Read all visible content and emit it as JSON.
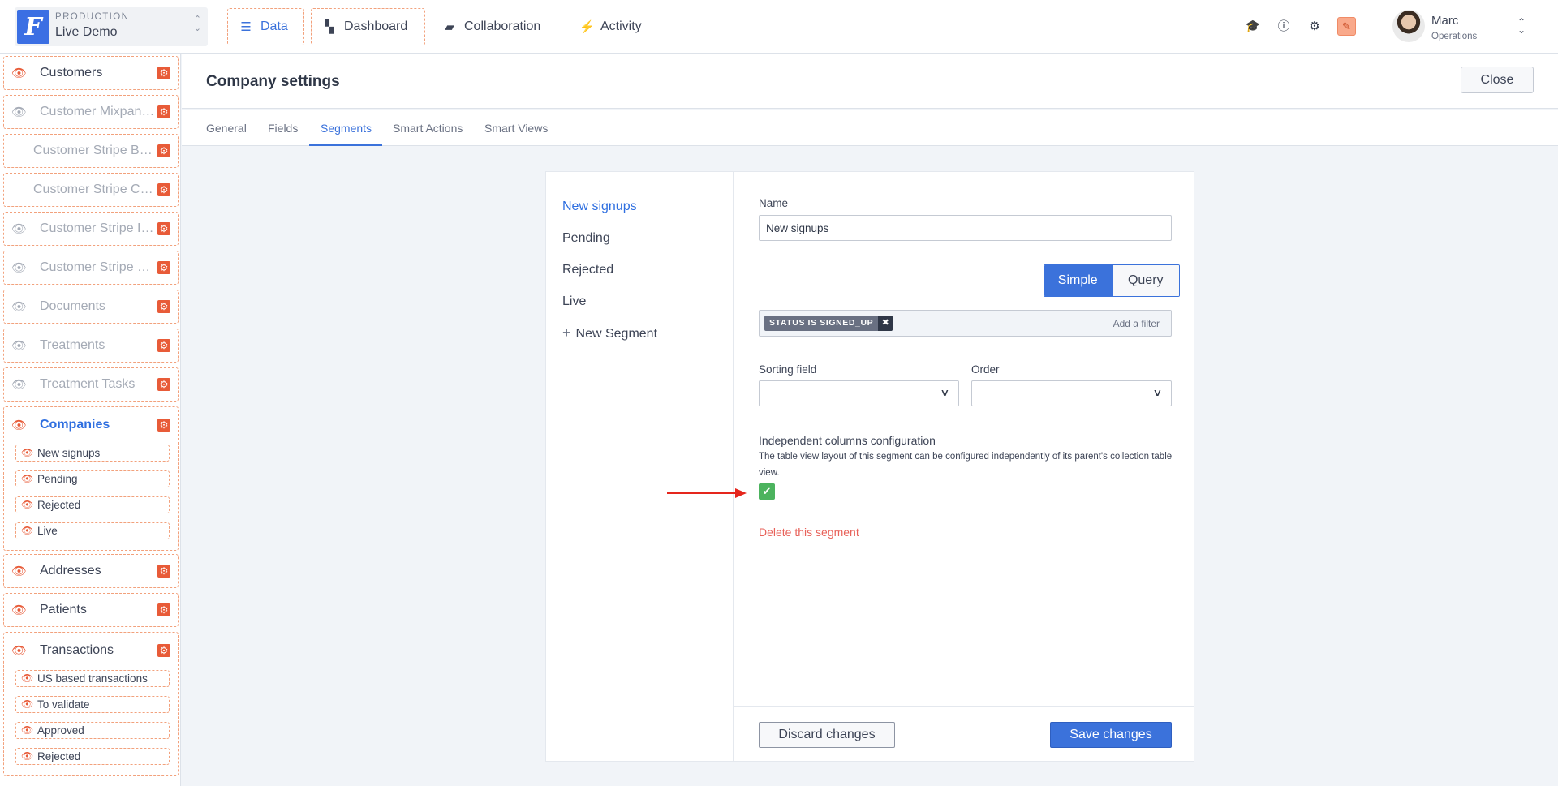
{
  "topbar": {
    "logo_letter": "F",
    "environment": "PRODUCTION",
    "project": "Live Demo",
    "nav": [
      {
        "label": "Data",
        "icon": "list-icon"
      },
      {
        "label": "Dashboard",
        "icon": "dashboard-icon"
      },
      {
        "label": "Collaboration",
        "icon": "chat-icon"
      },
      {
        "label": "Activity",
        "icon": "bolt-icon"
      }
    ],
    "icons": [
      "graduation-cap-icon",
      "help-icon",
      "gear-icon",
      "brush-icon"
    ],
    "user": {
      "name": "Marc",
      "role": "Operations"
    }
  },
  "sidebar": {
    "collections": [
      {
        "label": "Customers",
        "visible": true
      },
      {
        "label": "Customer Mixpanel Events",
        "visible": false
      },
      {
        "label": "Customer Stripe Bank Accounts",
        "visible": false,
        "no_eye": true
      },
      {
        "label": "Customer Stripe Cards",
        "visible": false,
        "no_eye": true
      },
      {
        "label": "Customer Stripe Invoices",
        "visible": false
      },
      {
        "label": "Customer Stripe Payments",
        "visible": false
      },
      {
        "label": "Documents",
        "visible": false
      },
      {
        "label": "Treatments",
        "visible": false
      },
      {
        "label": "Treatment Tasks",
        "visible": false
      }
    ],
    "companies": {
      "label": "Companies",
      "segments": [
        "New signups",
        "Pending",
        "Rejected",
        "Live"
      ]
    },
    "after": [
      {
        "label": "Addresses"
      },
      {
        "label": "Patients"
      }
    ],
    "transactions": {
      "label": "Transactions",
      "segments": [
        "US based transactions",
        "To validate",
        "Approved",
        "Rejected"
      ]
    }
  },
  "settings": {
    "title": "Company settings",
    "close_label": "Close",
    "tabs": [
      "General",
      "Fields",
      "Segments",
      "Smart Actions",
      "Smart Views"
    ],
    "active_tab": "Segments"
  },
  "segments": {
    "list": [
      "New signups",
      "Pending",
      "Rejected",
      "Live"
    ],
    "new_segment_label": "New Segment",
    "selected": "New signups"
  },
  "form": {
    "name_label": "Name",
    "name_value": "New signups",
    "mode_simple": "Simple",
    "mode_query": "Query",
    "active_mode": "Simple",
    "filter_chip": "STATUS IS SIGNED_UP",
    "add_filter": "Add a filter",
    "sorting_label": "Sorting field",
    "order_label": "Order",
    "sorting_value": "",
    "order_value": "",
    "indep_label": "Independent columns configuration",
    "indep_desc": "The table view layout of this segment can be configured independently of its parent's collection table view.",
    "indep_checked": true,
    "delete_label": "Delete this segment",
    "discard_label": "Discard changes",
    "save_label": "Save changes"
  },
  "colors": {
    "accent": "#3b72db",
    "danger": "#e85b38",
    "success": "#4cb35e",
    "annotation_arrow": "#e5261d"
  }
}
